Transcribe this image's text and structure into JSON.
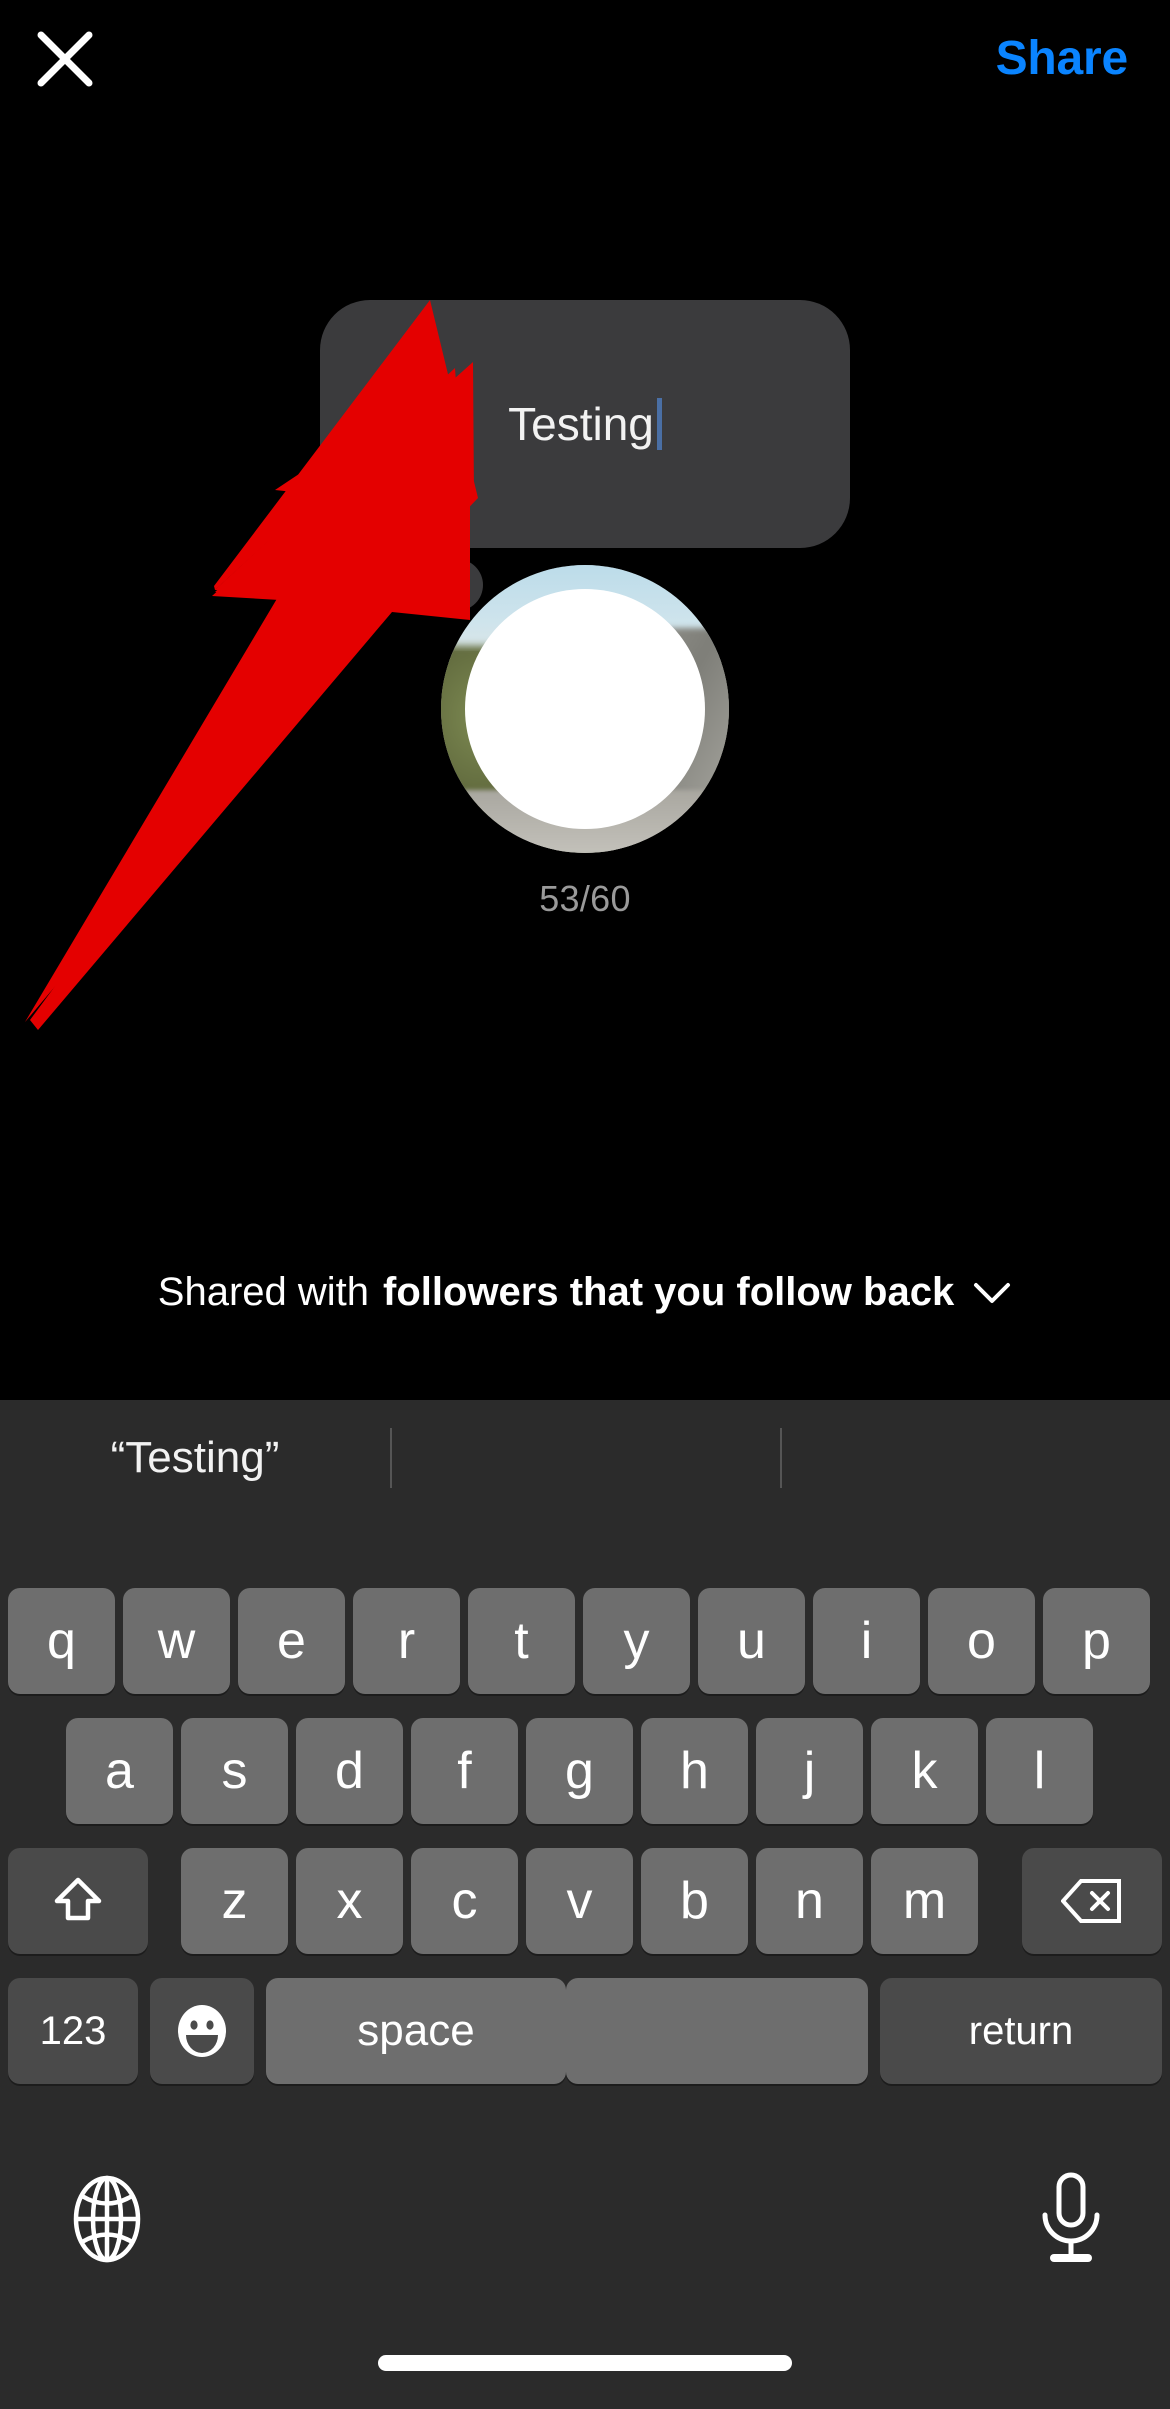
{
  "app": {
    "theme": "dark",
    "background_color": "#000000",
    "accent_color": "#0a84ff"
  },
  "topbar": {
    "close_icon": "close-x-icon",
    "share_label": "Share"
  },
  "composer": {
    "note_text": "Testing",
    "caret_color": "#4a6fa5",
    "bubble_color": "#3b3b3d",
    "char_counter": "53/60",
    "avatar_alt": "profile-photo"
  },
  "audience": {
    "prefix": "Shared with",
    "value": "followers that you follow back",
    "chevron_icon": "chevron-down-icon"
  },
  "annotation": {
    "arrow_color": "#e40000",
    "arrow_name": "red-pointer-arrow"
  },
  "keyboard": {
    "suggestions": [
      "“Testing”",
      "",
      ""
    ],
    "row1": [
      "q",
      "w",
      "e",
      "r",
      "t",
      "y",
      "u",
      "i",
      "o",
      "p"
    ],
    "row2": [
      "a",
      "s",
      "d",
      "f",
      "g",
      "h",
      "j",
      "k",
      "l"
    ],
    "row3": [
      "z",
      "x",
      "c",
      "v",
      "b",
      "n",
      "m"
    ],
    "shift_icon": "shift-up-arrow-icon",
    "backspace_icon": "backspace-delete-icon",
    "numbers_label": "123",
    "emoji_icon": "emoji-smiley-icon",
    "space_label": "space",
    "return_label": "return",
    "globe_icon": "globe-language-icon",
    "mic_icon": "microphone-dictation-icon",
    "key_color": "#6e6e6e",
    "modifier_key_color": "#4a4a4a",
    "keyboard_background": "#2b2b2b"
  }
}
